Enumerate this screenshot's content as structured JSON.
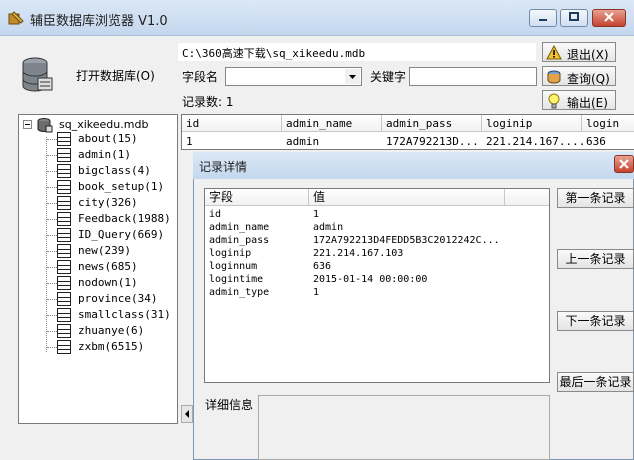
{
  "window": {
    "title": "辅臣数据库浏览器 V1.0"
  },
  "left": {
    "open_label": "打开数据库(O)",
    "tree": {
      "root": "sq_xikeedu.mdb",
      "items": [
        {
          "label": "about(15)"
        },
        {
          "label": "admin(1)"
        },
        {
          "label": "bigclass(4)"
        },
        {
          "label": "book_setup(1)"
        },
        {
          "label": "city(326)"
        },
        {
          "label": "Feedback(1988)"
        },
        {
          "label": "ID_Query(669)"
        },
        {
          "label": "new(239)"
        },
        {
          "label": "news(685)"
        },
        {
          "label": "nodown(1)"
        },
        {
          "label": "province(34)"
        },
        {
          "label": "smallclass(31)"
        },
        {
          "label": "zhuanye(6)"
        },
        {
          "label": "zxbm(6515)"
        }
      ]
    }
  },
  "top": {
    "path": "C:\\360高速下载\\sq_xikeedu.mdb",
    "field_label": "字段名",
    "keyword_label": "关键字",
    "count_text": "记录数: 1"
  },
  "buttons": {
    "exit": "退出(X)",
    "query": "查询(Q)",
    "export": "输出(E)"
  },
  "grid": {
    "headers": [
      "id",
      "admin_name",
      "admin_pass",
      "loginip",
      "login"
    ],
    "row": [
      "1",
      "admin",
      "172A792213D...",
      "221.214.167....",
      "636"
    ]
  },
  "dialog": {
    "title": "记录详情",
    "col_field": "字段",
    "col_value": "值",
    "rows": [
      {
        "field": "id",
        "value": "1"
      },
      {
        "field": "admin_name",
        "value": "admin"
      },
      {
        "field": "admin_pass",
        "value": "172A792213D4FEDD5B3C2012242C..."
      },
      {
        "field": "loginip",
        "value": "221.214.167.103"
      },
      {
        "field": "loginnum",
        "value": "636"
      },
      {
        "field": "logintime",
        "value": "2015-01-14 00:00:00"
      },
      {
        "field": "admin_type",
        "value": "1"
      }
    ],
    "nav": {
      "first": "第一条记录",
      "prev": "上一条记录",
      "next": "下一条记录",
      "last": "最后一条记录"
    },
    "detail_label": "详细信息"
  }
}
